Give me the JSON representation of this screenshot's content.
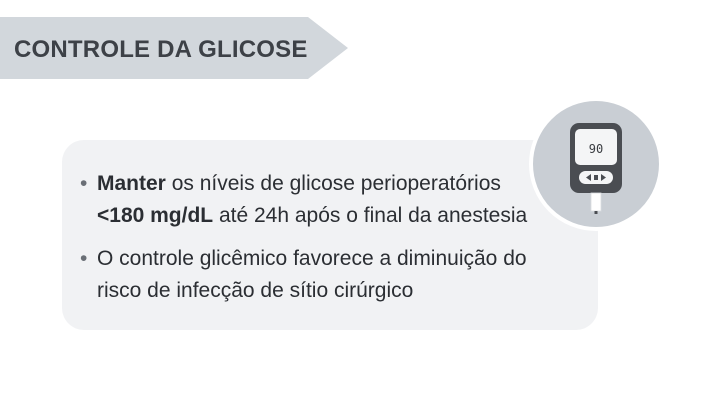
{
  "slide": {
    "title": "CONTROLE DA GLICOSE",
    "bullets": [
      {
        "bold_lead": "Manter",
        "text_a": " os níveis de glicose perioperatórios",
        "bold_value": "<180 mg/dL",
        "text_b": " até 24h após o final da anestesia"
      },
      {
        "text": "O controle glicêmico favorece a diminuição do risco de infecção de sítio cirúrgico"
      }
    ],
    "bullet_symbol": "•",
    "icon": {
      "name": "glucometer-icon",
      "reading": "90"
    }
  },
  "colors": {
    "banner": "#d2d7dc",
    "card": "#f1f2f4",
    "icon_circle": "#c9ced4",
    "device_body": "#4a4d52",
    "text": "#2b2e33"
  }
}
